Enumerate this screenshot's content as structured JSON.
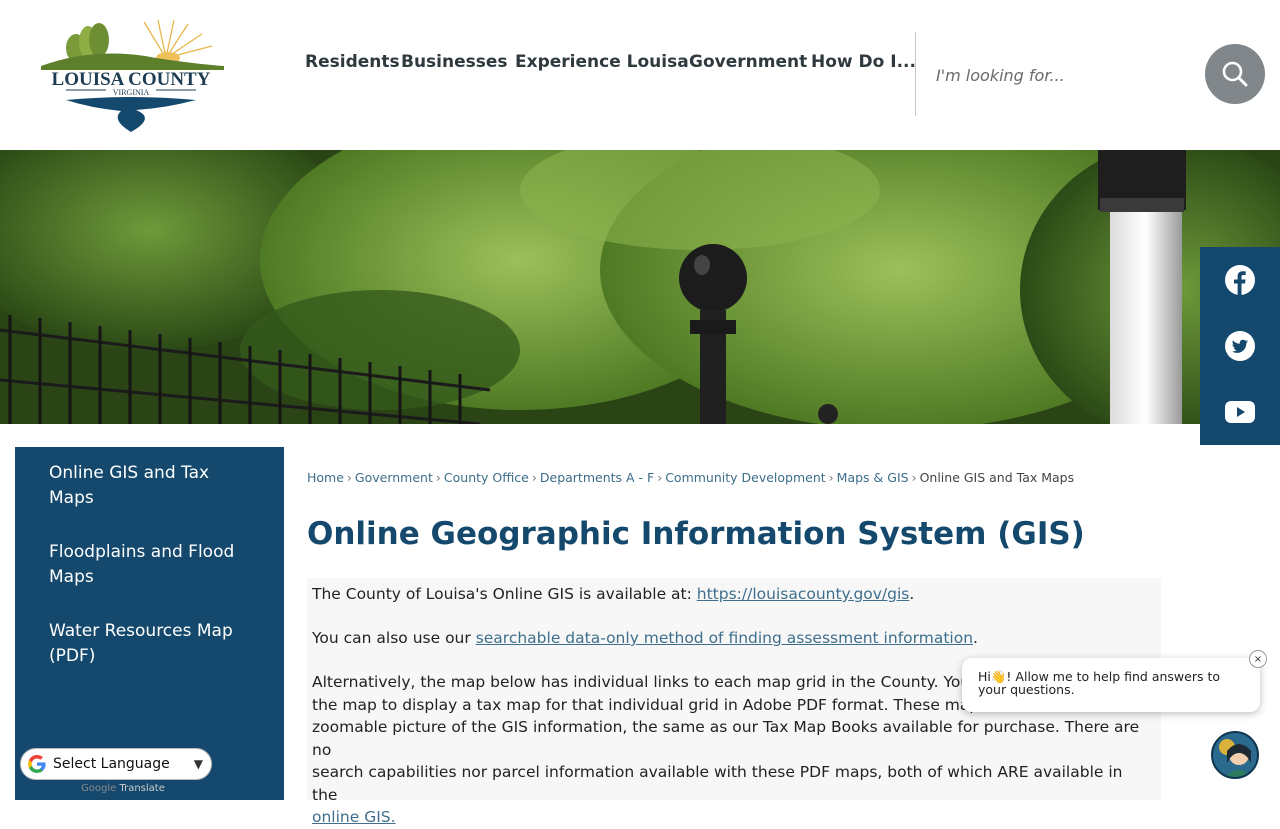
{
  "header": {
    "logo": {
      "name": "LOUISA COUNTY",
      "sub": "VIRGINIA"
    },
    "nav": [
      "Residents",
      "Businesses",
      "Experience Louisa",
      "Government",
      "How Do I..."
    ],
    "search": {
      "placeholder": "I'm looking for..."
    }
  },
  "social": [
    "facebook-icon",
    "twitter-icon",
    "youtube-icon"
  ],
  "sidebar": {
    "items": [
      {
        "label": "Online GIS and Tax Maps"
      },
      {
        "label": "Floodplains and Flood Maps"
      },
      {
        "label": "Water Resources Map (PDF)"
      }
    ]
  },
  "translate": {
    "label": "Select Language",
    "powered_by": "Google",
    "powered_suffix": "Translate"
  },
  "breadcrumb": {
    "items": [
      "Home",
      "Government",
      "County Office",
      "Departments A - F",
      "Community Development",
      "Maps & GIS"
    ],
    "current": "Online GIS and Tax Maps"
  },
  "main": {
    "title": "Online Geographic Information System (GIS)",
    "p1_text": "The County of Louisa's Online GIS is available at: ",
    "p1_link": "https://louisacounty.gov/gis",
    "p1_end": ".",
    "p2_text": "You can also use our ",
    "p2_link": "searchable data-only method of finding assessment information",
    "p2_end": ".",
    "p3_line1": "Alternatively, the map below has individual links to each map grid in the County. You c",
    "p3_line2": "the map to display a tax map for that individual grid in Adobe PDF format. These maps",
    "p3_line3": "zoomable picture of the GIS information, the same as our Tax Map Books available for purchase. There are no",
    "p3_line4": "search capabilities nor parcel information available with these PDF maps, both of which ARE available in the",
    "p3_link": "online GIS."
  },
  "chat": {
    "message": "Hi👋! Allow me to help find answers to your questions.",
    "close": "×"
  },
  "colors": {
    "brand": "#14496d",
    "search_button": "#80868a",
    "link": "#3f6f8c"
  }
}
